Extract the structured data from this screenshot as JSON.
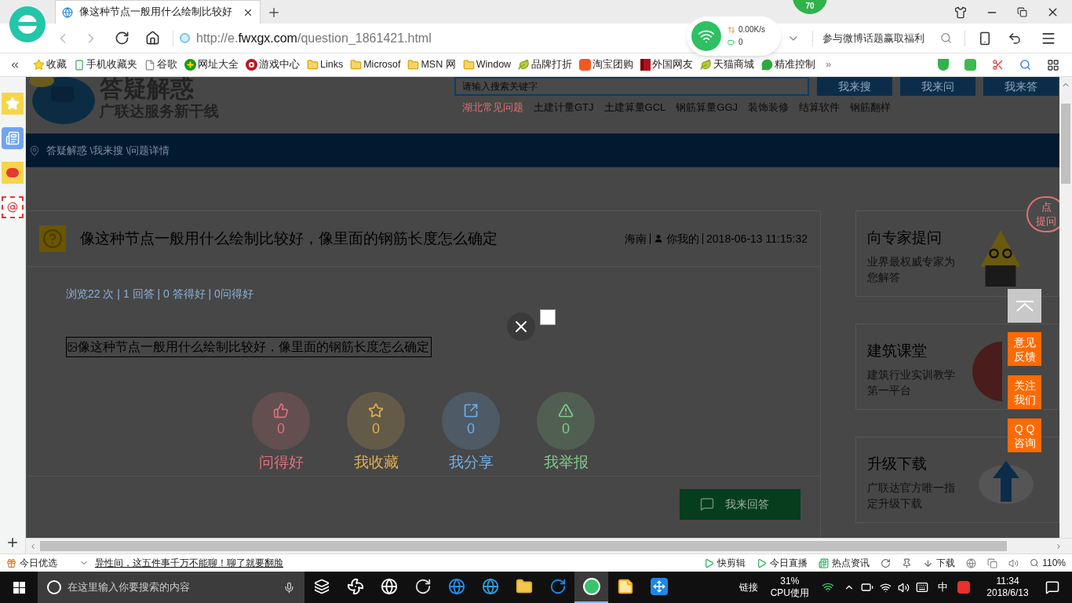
{
  "browser": {
    "tab": {
      "title": "像这种节点一般用什么绘制比较好",
      "selected": true
    },
    "badge": "70",
    "address": {
      "prefix": "http://e.",
      "domain": "fwxgx.com",
      "path": "/question_1861421.html"
    },
    "promo": "参与微博话题赢取福利",
    "network": {
      "speed": "0.00K/s",
      "count": "0"
    },
    "bookmarks": [
      {
        "label": "收藏",
        "kind": "star"
      },
      {
        "label": "手机收藏夹",
        "kind": "phone"
      },
      {
        "label": "谷歌",
        "kind": "page"
      },
      {
        "label": "网址大全",
        "kind": "plus"
      },
      {
        "label": "游戏中心",
        "kind": "game"
      },
      {
        "label": "Links",
        "kind": "folder"
      },
      {
        "label": "Microsof",
        "kind": "folder"
      },
      {
        "label": "MSN 网",
        "kind": "folder"
      },
      {
        "label": "Window",
        "kind": "folder"
      },
      {
        "label": "品牌打折",
        "kind": "leaf"
      },
      {
        "label": "淘宝团购",
        "kind": "tao"
      },
      {
        "label": "外国网友",
        "kind": "flag"
      },
      {
        "label": "天猫商城",
        "kind": "leaf"
      },
      {
        "label": "精准控制",
        "kind": "chat"
      }
    ],
    "more": "»"
  },
  "page": {
    "header": {
      "title": "答疑解惑",
      "slogan": "广联达服务新干线",
      "search_placeholder": "请输入搜索关键字",
      "buttons": [
        "我来搜",
        "我来问",
        "我来答"
      ],
      "links": [
        {
          "label": "湖北常见问题",
          "selected": true
        },
        {
          "label": "土建计量GTJ",
          "selected": false
        },
        {
          "label": "土建算量GCL",
          "selected": false
        },
        {
          "label": "钢筋算量GGJ",
          "selected": false
        },
        {
          "label": "装饰装修",
          "selected": false
        },
        {
          "label": "结算软件",
          "selected": false
        },
        {
          "label": "钢筋翻样",
          "selected": false
        }
      ]
    },
    "breadcrumb": "答疑解惑 \\我来搜 \\问题详情",
    "question": {
      "title": "像这种节点一般用什么绘制比较好，像里面的钢筋长度怎么确定",
      "region": "海南",
      "user": "你我的",
      "time": "2018-06-13 11:15:32",
      "stats": "浏览22 次 | 1 回答 | 0 答得好 | 0问得好",
      "image_alt": "像这种节点一般用什么绘制比较好，像里面的钢筋长度怎么确定",
      "actions": [
        {
          "kind": "like",
          "count": "0",
          "label": "问得好",
          "color": "#e0707c"
        },
        {
          "kind": "favorite",
          "count": "0",
          "label": "我收藏",
          "color": "#e0b050"
        },
        {
          "kind": "share",
          "count": "0",
          "label": "我分享",
          "color": "#70b0e8"
        },
        {
          "kind": "report",
          "count": "0",
          "label": "我举报",
          "color": "#80cc88"
        }
      ],
      "answer_button": "我来回答"
    },
    "side_cards": [
      {
        "kind": "expert",
        "title": "向专家提问",
        "desc": "业界最权威专家为您解答"
      },
      {
        "kind": "class",
        "title": "建筑课堂",
        "desc": "建筑行业实训教学第一平台"
      },
      {
        "kind": "download",
        "title": "升级下载",
        "desc": "广联达官方唯一指定升级下载"
      }
    ],
    "bubble": [
      "点",
      "提问"
    ],
    "float_buttons": [
      {
        "kind": "top"
      },
      {
        "kind": "text",
        "lines": [
          "意见",
          "反馈"
        ]
      },
      {
        "kind": "text",
        "lines": [
          "关注",
          "我们"
        ]
      },
      {
        "kind": "text",
        "lines": [
          "Q Q",
          "咨询"
        ]
      }
    ]
  },
  "status_bar": {
    "pick": "今日优选",
    "news": "异性间，这五件事千万不能聊！聊了就要翻脸",
    "items": [
      {
        "kind": "clip",
        "label": "快剪辑"
      },
      {
        "kind": "live",
        "label": "今日直播"
      },
      {
        "kind": "news",
        "label": "热点资讯"
      }
    ],
    "download": "下载",
    "zoom": "110%"
  },
  "taskbar": {
    "search_placeholder": "在这里输入你要搜索的内容",
    "apps": [
      {
        "kind": "view",
        "selected": false
      },
      {
        "kind": "fan",
        "selected": false
      },
      {
        "kind": "ie-old",
        "selected": false
      },
      {
        "kind": "swirl",
        "selected": false
      },
      {
        "kind": "edge",
        "selected": false
      },
      {
        "kind": "ie",
        "selected": false
      },
      {
        "kind": "folder",
        "selected": false
      },
      {
        "kind": "g",
        "selected": false
      },
      {
        "kind": "browser",
        "selected": true
      },
      {
        "kind": "notes",
        "selected": false
      },
      {
        "kind": "move",
        "selected": false
      }
    ],
    "link": "链接",
    "cpu": "31%",
    "cpu_label": "CPU使用",
    "ime": "中",
    "time": "11:34",
    "date": "2018/6/13"
  }
}
